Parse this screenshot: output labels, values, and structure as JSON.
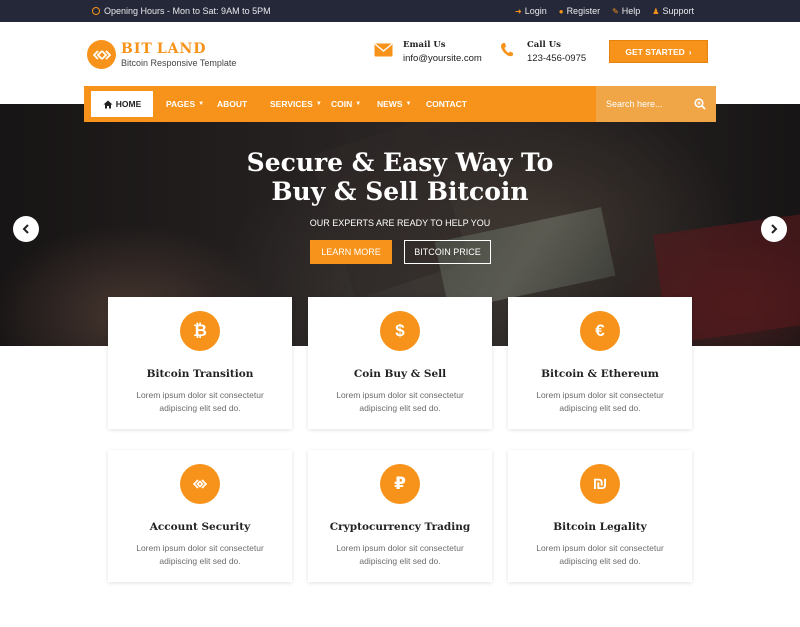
{
  "topbar": {
    "hours": "Opening Hours - Mon to Sat: 9AM to 5PM",
    "links": [
      "Login",
      "Register",
      "Help",
      "Support"
    ]
  },
  "logo": {
    "name_part1": "BIT",
    "name_part2": "LAND",
    "tagline": "Bitcoin Responsive Template"
  },
  "contact": {
    "email_label": "Email Us",
    "email_value": "info@yoursite.com",
    "call_label": "Call Us",
    "call_value": "123-456-0975"
  },
  "cta": {
    "get_started": "GET STARTED"
  },
  "nav": {
    "home": "HOME",
    "items": [
      "PAGES",
      "ABOUT",
      "SERVICES",
      "COIN",
      "NEWS",
      "CONTACT"
    ],
    "search_placeholder": "Search here..."
  },
  "hero": {
    "title_line1": "Secure & Easy Way To",
    "title_line2": "Buy & Sell Bitcoin",
    "subtitle": "OUR EXPERTS ARE READY TO HELP YOU",
    "learn_more": "LEARN MORE",
    "bitcoin_price": "BITCOIN PRICE"
  },
  "features": [
    {
      "icon": "bitcoin-icon",
      "glyph": "₿",
      "title": "Bitcoin Transition",
      "desc": "Lorem ipsum dolor sit consectetur adipiscing elit sed do."
    },
    {
      "icon": "dollar-icon",
      "glyph": "$",
      "title": "Coin Buy & Sell",
      "desc": "Lorem ipsum dolor sit consectetur adipiscing elit sed do."
    },
    {
      "icon": "euro-icon",
      "glyph": "€",
      "title": "Bitcoin & Ethereum",
      "desc": "Lorem ipsum dolor sit consectetur adipiscing elit sed do."
    },
    {
      "icon": "link-icon",
      "glyph": "",
      "title": "Account Security",
      "desc": "Lorem ipsum dolor sit consectetur adipiscing elit sed do."
    },
    {
      "icon": "ruble-icon",
      "glyph": "₽",
      "title": "Cryptocurrency Trading",
      "desc": "Lorem ipsum dolor sit consectetur adipiscing elit sed do."
    },
    {
      "icon": "shekel-icon",
      "glyph": "₪",
      "title": "Bitcoin Legality",
      "desc": "Lorem ipsum dolor sit consectetur adipiscing elit sed do."
    }
  ],
  "colors": {
    "accent": "#f7931a",
    "topbar": "#252838"
  }
}
